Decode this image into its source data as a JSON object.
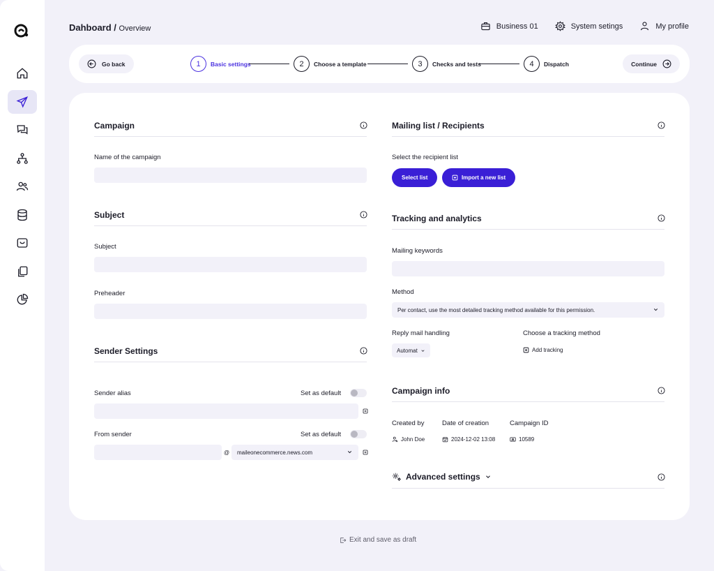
{
  "header": {
    "title": "Dahboard /",
    "subtitle": "Overview"
  },
  "top_actions": [
    {
      "icon": "briefcase-icon",
      "label": "Business 01"
    },
    {
      "icon": "gear-icon",
      "label": "System setings"
    },
    {
      "icon": "user-icon",
      "label": "My profile"
    }
  ],
  "sidebar": {
    "items": [
      {
        "icon": "home-icon"
      },
      {
        "icon": "send-icon",
        "active": true
      },
      {
        "icon": "chat-icon"
      },
      {
        "icon": "hierarchy-icon"
      },
      {
        "icon": "users-icon"
      },
      {
        "icon": "database-icon"
      },
      {
        "icon": "inbox-icon"
      },
      {
        "icon": "copy-icon"
      },
      {
        "icon": "pie-chart-icon"
      }
    ]
  },
  "stepper": {
    "back_label": "Go back",
    "continue_label": "Continue",
    "steps": [
      {
        "num": "1",
        "label": "Basic settings",
        "active": true
      },
      {
        "num": "2",
        "label": "Choose a template"
      },
      {
        "num": "3",
        "label": "Checks and tests"
      },
      {
        "num": "4",
        "label": "Dispatch"
      }
    ]
  },
  "campaign": {
    "title": "Campaign",
    "name_label": "Name of the campaign",
    "name_value": ""
  },
  "subject": {
    "title": "Subject",
    "subject_label": "Subject",
    "subject_value": "",
    "preheader_label": "Preheader",
    "preheader_value": ""
  },
  "sender": {
    "title": "Sender Settings",
    "alias_label": "Sender alias",
    "alias_default_label": "Set as default",
    "alias_value": "",
    "from_label": "From sender",
    "from_default_label": "Set as default",
    "from_local_value": "",
    "at_sign": "@",
    "from_domain_value": "maileonecommerce.news.com"
  },
  "mailing": {
    "title": "Mailing list / Recipients",
    "select_label": "Select the recipient list",
    "select_btn": "Select list",
    "import_btn": "Import a new list"
  },
  "tracking": {
    "title": "Tracking and analytics",
    "keywords_label": "Mailing keywords",
    "keywords_value": "",
    "method_label": "Method",
    "method_value": "Per contact, use the most detailed tracking method available for this permission.",
    "reply_label": "Reply mail handling",
    "reply_value": "Automat",
    "choose_label": "Choose a tracking method",
    "add_tracking": "Add tracking"
  },
  "campaign_info": {
    "title": "Campaign info",
    "created_by_label": "Created by",
    "created_by_value": "John Doe",
    "date_label": "Date of creation",
    "date_value": "2024-12-02 13:08",
    "id_label": "Campaign ID",
    "id_value": "10589"
  },
  "advanced": {
    "title": "Advanced settings"
  },
  "footer": {
    "exit_label": "Exit and save as draft"
  },
  "colors": {
    "accent": "#3a1fd6",
    "background": "#f2f1f9",
    "card": "#ffffff"
  }
}
